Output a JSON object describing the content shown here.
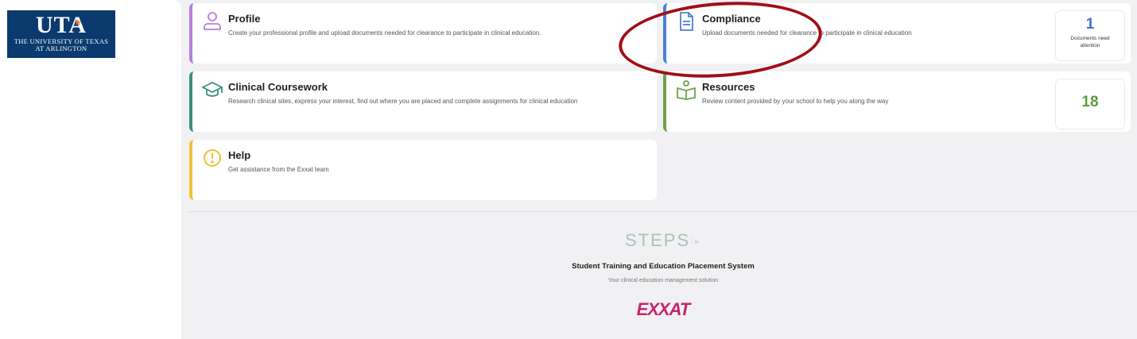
{
  "logo": {
    "main": "UTA",
    "line1": "THE UNIVERSITY OF TEXAS",
    "line2": "AT ARLINGTON"
  },
  "cards": {
    "profile": {
      "title": "Profile",
      "description": "Create your professional profile and upload documents needed for clearance to participate in clinical education.",
      "icon": "person-icon",
      "accent": "#b47fdc"
    },
    "compliance": {
      "title": "Compliance",
      "description": "Upload documents needed for clearance to participate in clinical education",
      "icon": "document-icon",
      "accent": "#4a7fd6",
      "count": "1",
      "count_label": "Documents need attention"
    },
    "coursework": {
      "title": "Clinical Coursework",
      "description": "Research clinical sites, express your interest, find out where you are placed and complete assignments for clinical education",
      "icon": "graduation-cap-icon",
      "accent": "#3e8f7d"
    },
    "resources": {
      "title": "Resources",
      "description": "Review content provided by your school to help you along the way",
      "icon": "book-person-icon",
      "accent": "#6ba34c",
      "count": "18"
    },
    "help": {
      "title": "Help",
      "description": "Get assistance from the Exxat team",
      "icon": "exclamation-circle-icon",
      "accent": "#f1c232"
    }
  },
  "footer": {
    "steps_logo": "STEPS",
    "system_name": "Student Training and Education Placement System",
    "tagline": "Your clinical education management solution",
    "exxat_logo": "EXXAT"
  },
  "annotation": {
    "color": "#a10e14"
  }
}
